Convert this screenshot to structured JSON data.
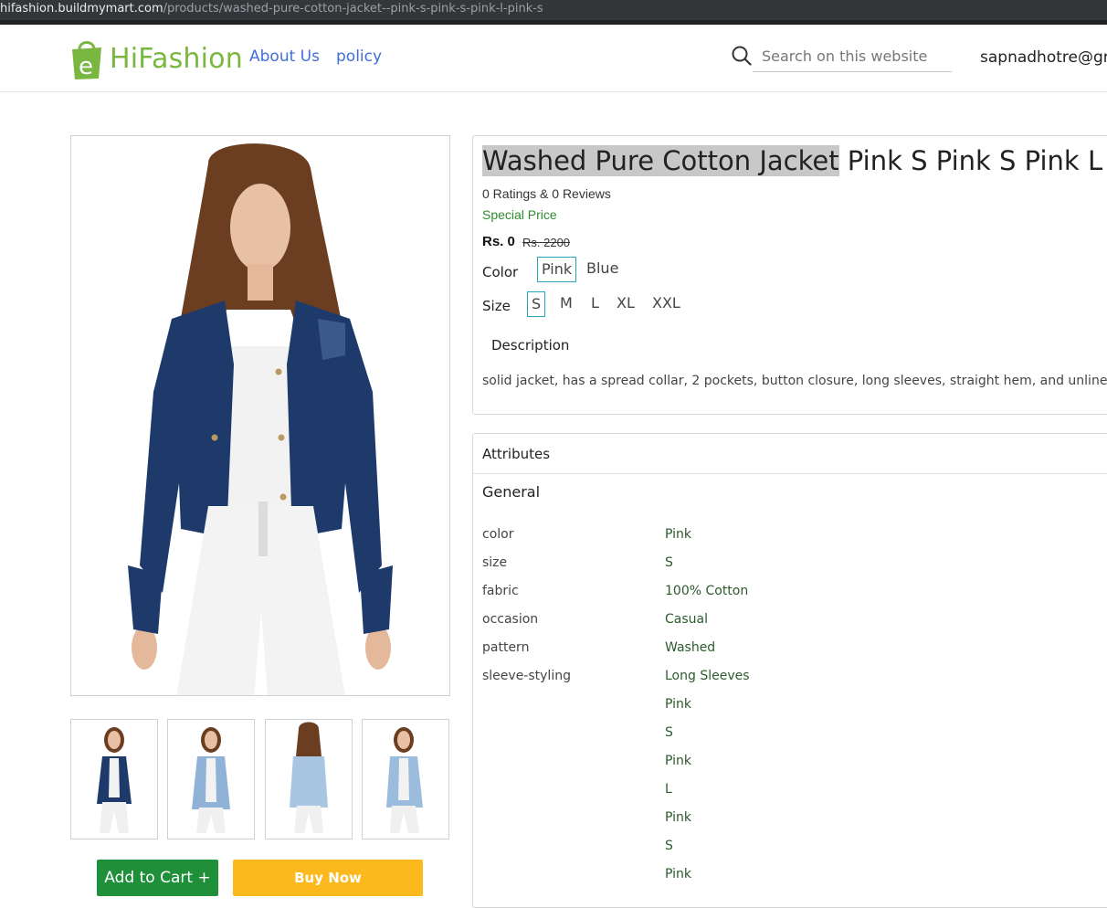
{
  "browser": {
    "url_host": "hifashion.buildmymart.com",
    "url_path": "/products/washed-pure-cotton-jacket--pink-s-pink-s-pink-l-pink-s"
  },
  "header": {
    "logo_text": "HiFashion",
    "nav": [
      {
        "label": "About Us"
      },
      {
        "label": "policy"
      }
    ],
    "search_placeholder": "Search on this website",
    "user_email": "sapnadhotre@gr"
  },
  "product": {
    "title_highlight": "Washed Pure Cotton Jacket",
    "title_rest": " Pink S Pink S Pink L Pin",
    "ratings": "0 Ratings & 0 Reviews",
    "special_price_label": "Special Price",
    "price": "Rs. 0",
    "mrp": "Rs. 2200",
    "color_label": "Color",
    "colors": [
      "Pink",
      "Blue"
    ],
    "selected_color": "Pink",
    "size_label": "Size",
    "sizes": [
      "S",
      "M",
      "L",
      "XL",
      "XXL"
    ],
    "selected_size": "S",
    "description_label": "Description",
    "description": "solid jacket, has a spread collar, 2 pockets, button closure, long sleeves, straight hem, and unlined li"
  },
  "actions": {
    "add_to_cart": "Add to Cart +",
    "buy_now": "Buy Now"
  },
  "attributes": {
    "title": "Attributes",
    "group": "General",
    "rows": [
      {
        "key": "color",
        "value": "Pink"
      },
      {
        "key": "size",
        "value": "S"
      },
      {
        "key": "fabric",
        "value": "100% Cotton"
      },
      {
        "key": "occasion",
        "value": "Casual"
      },
      {
        "key": "pattern",
        "value": "Washed"
      },
      {
        "key": "sleeve-styling",
        "value": "Long Sleeves"
      },
      {
        "key": "",
        "value": "Pink"
      },
      {
        "key": "",
        "value": "S"
      },
      {
        "key": "",
        "value": "Pink"
      },
      {
        "key": "",
        "value": "L"
      },
      {
        "key": "",
        "value": "Pink"
      },
      {
        "key": "",
        "value": "S"
      },
      {
        "key": "",
        "value": "Pink"
      }
    ]
  },
  "colors": {
    "brand_green": "#7ab740",
    "nav_blue": "#3f6fd8",
    "cart_green": "#1f8f3a",
    "buy_yellow": "#fbb91d",
    "selected_border": "#26a5b8",
    "special_price_green": "#2e8b2e"
  },
  "icons": {
    "logo": "shopping-bag-e-icon",
    "search": "magnifier-icon"
  }
}
